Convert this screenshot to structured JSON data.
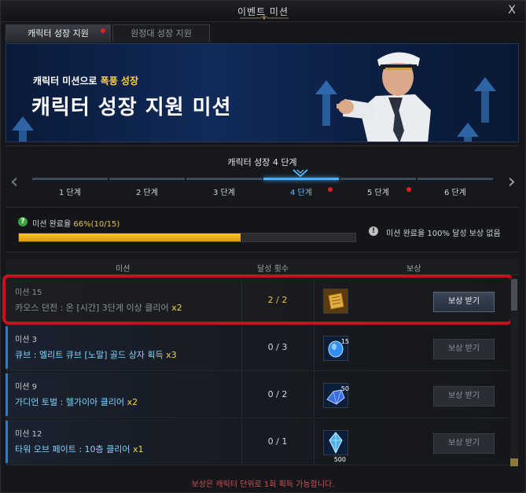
{
  "window": {
    "title": "이벤트 미션",
    "close_label": "X"
  },
  "tabs": [
    {
      "label": "캐릭터 성장 지원",
      "active": true,
      "has_alert": true
    },
    {
      "label": "원정대 성장 지원",
      "active": false,
      "has_alert": false
    }
  ],
  "banner": {
    "subtitle_prefix": "캐릭터 미션으로",
    "subtitle_highlight": "폭풍 성장",
    "title": "캐릭터 성장 지원 미션"
  },
  "stage": {
    "title": "캐릭터 성장 4 단계",
    "steps": [
      {
        "label": "1 단계",
        "active": false,
        "alert": false
      },
      {
        "label": "2 단계",
        "active": false,
        "alert": false
      },
      {
        "label": "3 단계",
        "active": false,
        "alert": false
      },
      {
        "label": "4 단계",
        "active": true,
        "alert": true
      },
      {
        "label": "5 단계",
        "active": false,
        "alert": true
      },
      {
        "label": "6 단계",
        "active": false,
        "alert": false
      }
    ]
  },
  "progress": {
    "label": "미션 완료율",
    "value_text": "66%(10/15)",
    "fraction": 0.66,
    "info_text": "미션 완료율 100% 달성 보상 없음"
  },
  "columns": {
    "mission": "미션",
    "count": "달성 횟수",
    "reward": "보상"
  },
  "missions": [
    {
      "name": "미션 15",
      "desc": "카오스 던전 : 온 [시간] 3단계 이상 클리어",
      "mult": "x2",
      "count": "2 / 2",
      "reward_icon": "gold-ticket-icon",
      "reward_qty": "",
      "button": "보상 받기",
      "done": true
    },
    {
      "name": "미션 3",
      "desc": "큐브 : 엘리트 큐브 [노말] 골드 상자 획득",
      "mult": "x3",
      "count": "0 / 3",
      "reward_icon": "blue-gem-icon",
      "reward_qty": "15",
      "button": "보상 받기",
      "done": false
    },
    {
      "name": "미션 9",
      "desc": "가디언 토벌 : 헬가이아 클리어",
      "mult": "x2",
      "count": "0 / 2",
      "reward_icon": "blue-crystal-icon",
      "reward_qty": "50",
      "button": "보상 받기",
      "done": false
    },
    {
      "name": "미션 12",
      "desc": "타워 오브 페이트 : 10층 클리어",
      "mult": "x1",
      "count": "0 / 1",
      "reward_icon": "crystal-shard-icon",
      "reward_qty": "500",
      "button": "보상 받기",
      "done": false
    }
  ],
  "footer": "보상은 캐릭터 단위로 1회 획득 가능합니다."
}
